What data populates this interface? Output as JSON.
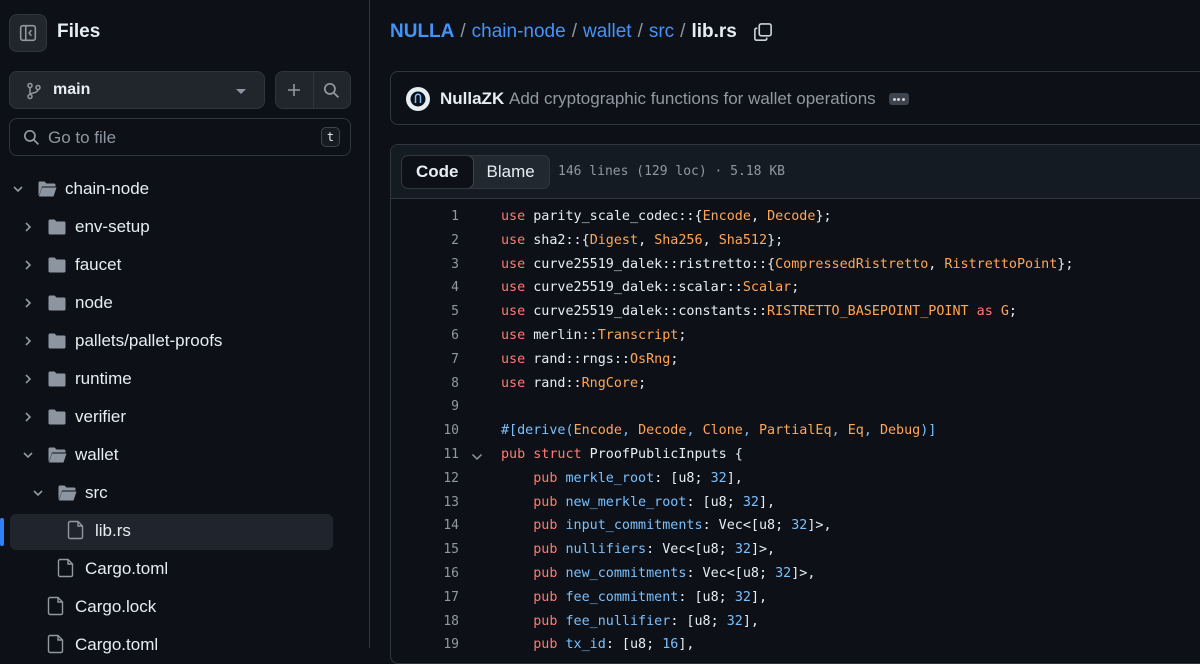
{
  "sidebar": {
    "title": "Files",
    "branch": "main",
    "goto_placeholder": "Go to file",
    "goto_shortcut": "t",
    "tree": [
      {
        "label": "chain-node",
        "type": "folder",
        "expanded": true,
        "depth": 0
      },
      {
        "label": "env-setup",
        "type": "folder",
        "expanded": false,
        "depth": 1
      },
      {
        "label": "faucet",
        "type": "folder",
        "expanded": false,
        "depth": 1
      },
      {
        "label": "node",
        "type": "folder",
        "expanded": false,
        "depth": 1
      },
      {
        "label": "pallets/pallet-proofs",
        "type": "folder",
        "expanded": false,
        "depth": 1
      },
      {
        "label": "runtime",
        "type": "folder",
        "expanded": false,
        "depth": 1
      },
      {
        "label": "verifier",
        "type": "folder",
        "expanded": false,
        "depth": 1
      },
      {
        "label": "wallet",
        "type": "folder",
        "expanded": true,
        "depth": 1
      },
      {
        "label": "src",
        "type": "folder",
        "expanded": true,
        "depth": 2
      },
      {
        "label": "lib.rs",
        "type": "file",
        "depth": 3,
        "selected": true
      },
      {
        "label": "Cargo.toml",
        "type": "file",
        "depth": 2
      },
      {
        "label": "Cargo.lock",
        "type": "file",
        "depth": 1
      },
      {
        "label": "Cargo.toml",
        "type": "file",
        "depth": 1
      }
    ]
  },
  "breadcrumb": {
    "root": "NULLA",
    "parts": [
      "chain-node",
      "wallet",
      "src"
    ],
    "current": "lib.rs",
    "sep": "/"
  },
  "commit": {
    "author": "NullaZK",
    "message": "Add cryptographic functions for wallet operations"
  },
  "file": {
    "tabs": [
      "Code",
      "Blame"
    ],
    "active_tab": "Code",
    "meta": "146 lines (129 loc) · 5.18 KB"
  },
  "code_lines": [
    {
      "n": "1",
      "tokens": [
        [
          "kw",
          "use"
        ],
        [
          "pl",
          " parity_scale_codec::{"
        ],
        [
          "ty",
          "Encode"
        ],
        [
          "pl",
          ", "
        ],
        [
          "ty",
          "Decode"
        ],
        [
          "pl",
          "};"
        ]
      ]
    },
    {
      "n": "2",
      "tokens": [
        [
          "kw",
          "use"
        ],
        [
          "pl",
          " sha2::{"
        ],
        [
          "ty",
          "Digest"
        ],
        [
          "pl",
          ", "
        ],
        [
          "ty",
          "Sha256"
        ],
        [
          "pl",
          ", "
        ],
        [
          "ty",
          "Sha512"
        ],
        [
          "pl",
          "};"
        ]
      ]
    },
    {
      "n": "3",
      "tokens": [
        [
          "kw",
          "use"
        ],
        [
          "pl",
          " curve25519_dalek::ristretto::{"
        ],
        [
          "ty",
          "CompressedRistretto"
        ],
        [
          "pl",
          ", "
        ],
        [
          "ty",
          "RistrettoPoint"
        ],
        [
          "pl",
          "};"
        ]
      ]
    },
    {
      "n": "4",
      "tokens": [
        [
          "kw",
          "use"
        ],
        [
          "pl",
          " curve25519_dalek::scalar::"
        ],
        [
          "ty",
          "Scalar"
        ],
        [
          "pl",
          ";"
        ]
      ]
    },
    {
      "n": "5",
      "tokens": [
        [
          "kw",
          "use"
        ],
        [
          "pl",
          " curve25519_dalek::constants::"
        ],
        [
          "ty",
          "RISTRETTO_BASEPOINT_POINT"
        ],
        [
          "pl",
          " "
        ],
        [
          "kw",
          "as"
        ],
        [
          "pl",
          " "
        ],
        [
          "ty",
          "G"
        ],
        [
          "pl",
          ";"
        ]
      ]
    },
    {
      "n": "6",
      "tokens": [
        [
          "kw",
          "use"
        ],
        [
          "pl",
          " merlin::"
        ],
        [
          "ty",
          "Transcript"
        ],
        [
          "pl",
          ";"
        ]
      ]
    },
    {
      "n": "7",
      "tokens": [
        [
          "kw",
          "use"
        ],
        [
          "pl",
          " rand::rngs::"
        ],
        [
          "ty",
          "OsRng"
        ],
        [
          "pl",
          ";"
        ]
      ]
    },
    {
      "n": "8",
      "tokens": [
        [
          "kw",
          "use"
        ],
        [
          "pl",
          " rand::"
        ],
        [
          "ty",
          "RngCore"
        ],
        [
          "pl",
          ";"
        ]
      ]
    },
    {
      "n": "9",
      "tokens": []
    },
    {
      "n": "10",
      "tokens": [
        [
          "at",
          "#[derive("
        ],
        [
          "ty",
          "Encode"
        ],
        [
          "at",
          ", "
        ],
        [
          "ty",
          "Decode"
        ],
        [
          "at",
          ", "
        ],
        [
          "ty",
          "Clone"
        ],
        [
          "at",
          ", "
        ],
        [
          "ty",
          "PartialEq"
        ],
        [
          "at",
          ", "
        ],
        [
          "ty",
          "Eq"
        ],
        [
          "at",
          ", "
        ],
        [
          "ty",
          "Debug"
        ],
        [
          "at",
          ")]"
        ]
      ]
    },
    {
      "n": "11",
      "fold": true,
      "tokens": [
        [
          "kw",
          "pub"
        ],
        [
          "pl",
          " "
        ],
        [
          "kw",
          "struct"
        ],
        [
          "pl",
          " ProofPublicInputs {"
        ]
      ]
    },
    {
      "n": "12",
      "tokens": [
        [
          "pl",
          "    "
        ],
        [
          "kw",
          "pub"
        ],
        [
          "pl",
          " "
        ],
        [
          "nm",
          "merkle_root"
        ],
        [
          "pl",
          ": [u8; "
        ],
        [
          "nm",
          "32"
        ],
        [
          "pl",
          "],"
        ]
      ]
    },
    {
      "n": "13",
      "tokens": [
        [
          "pl",
          "    "
        ],
        [
          "kw",
          "pub"
        ],
        [
          "pl",
          " "
        ],
        [
          "nm",
          "new_merkle_root"
        ],
        [
          "pl",
          ": [u8; "
        ],
        [
          "nm",
          "32"
        ],
        [
          "pl",
          "],"
        ]
      ]
    },
    {
      "n": "14",
      "tokens": [
        [
          "pl",
          "    "
        ],
        [
          "kw",
          "pub"
        ],
        [
          "pl",
          " "
        ],
        [
          "nm",
          "input_commitments"
        ],
        [
          "pl",
          ": Vec<[u8; "
        ],
        [
          "nm",
          "32"
        ],
        [
          "pl",
          "]>,"
        ]
      ]
    },
    {
      "n": "15",
      "tokens": [
        [
          "pl",
          "    "
        ],
        [
          "kw",
          "pub"
        ],
        [
          "pl",
          " "
        ],
        [
          "nm",
          "nullifiers"
        ],
        [
          "pl",
          ": Vec<[u8; "
        ],
        [
          "nm",
          "32"
        ],
        [
          "pl",
          "]>,"
        ]
      ]
    },
    {
      "n": "16",
      "tokens": [
        [
          "pl",
          "    "
        ],
        [
          "kw",
          "pub"
        ],
        [
          "pl",
          " "
        ],
        [
          "nm",
          "new_commitments"
        ],
        [
          "pl",
          ": Vec<[u8; "
        ],
        [
          "nm",
          "32"
        ],
        [
          "pl",
          "]>,"
        ]
      ]
    },
    {
      "n": "17",
      "tokens": [
        [
          "pl",
          "    "
        ],
        [
          "kw",
          "pub"
        ],
        [
          "pl",
          " "
        ],
        [
          "nm",
          "fee_commitment"
        ],
        [
          "pl",
          ": [u8; "
        ],
        [
          "nm",
          "32"
        ],
        [
          "pl",
          "],"
        ]
      ]
    },
    {
      "n": "18",
      "tokens": [
        [
          "pl",
          "    "
        ],
        [
          "kw",
          "pub"
        ],
        [
          "pl",
          " "
        ],
        [
          "nm",
          "fee_nullifier"
        ],
        [
          "pl",
          ": [u8; "
        ],
        [
          "nm",
          "32"
        ],
        [
          "pl",
          "],"
        ]
      ]
    },
    {
      "n": "19",
      "tokens": [
        [
          "pl",
          "    "
        ],
        [
          "kw",
          "pub"
        ],
        [
          "pl",
          " "
        ],
        [
          "nm",
          "tx_id"
        ],
        [
          "pl",
          ": [u8; "
        ],
        [
          "nm",
          "16"
        ],
        [
          "pl",
          "],"
        ]
      ]
    }
  ],
  "colors": {
    "accent": "#4493f8",
    "keyword": "#ff7b72",
    "type": "#ffa657",
    "constant": "#79c0ff",
    "background": "#0d1117",
    "selected_bar": "#2f81f7"
  }
}
